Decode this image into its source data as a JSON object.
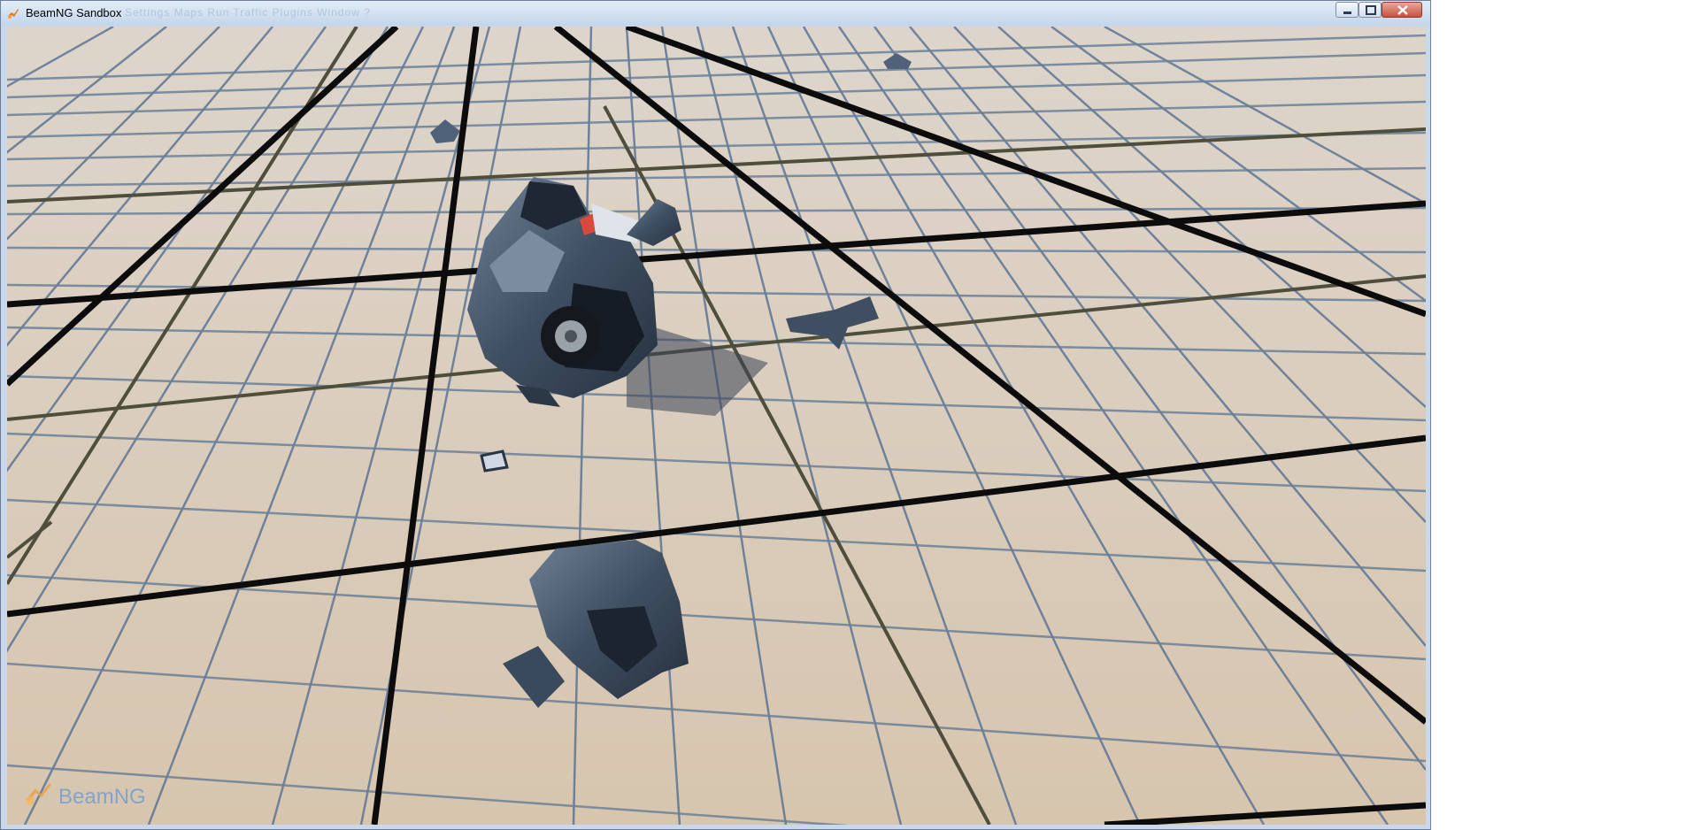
{
  "window": {
    "title": "BeamNG Sandbox",
    "menu_ghost": "Settings   Maps   Run   Traffic   Plugins   Window   ?",
    "controls": [
      "minimize",
      "maximize",
      "close"
    ]
  },
  "viewport": {
    "logo_text": "BeamNG",
    "icons": {
      "app": "beamng-app-icon",
      "logo": "beamng-logo-icon"
    }
  }
}
